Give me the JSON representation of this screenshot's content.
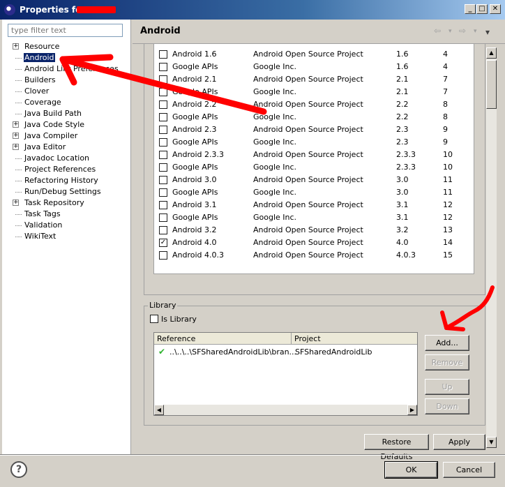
{
  "window": {
    "title": "Properties for",
    "buttons": {
      "minimize": "_",
      "maximize": "□",
      "close": "✕"
    }
  },
  "filter": {
    "placeholder": "type filter text"
  },
  "tree": [
    {
      "label": "Resource",
      "expandable": true,
      "selected": false
    },
    {
      "label": "Android",
      "expandable": false,
      "selected": true
    },
    {
      "label": "Android Lint Preferences",
      "expandable": false,
      "selected": false
    },
    {
      "label": "Builders",
      "expandable": false,
      "selected": false
    },
    {
      "label": "Clover",
      "expandable": false,
      "selected": false
    },
    {
      "label": "Coverage",
      "expandable": false,
      "selected": false
    },
    {
      "label": "Java Build Path",
      "expandable": false,
      "selected": false
    },
    {
      "label": "Java Code Style",
      "expandable": true,
      "selected": false
    },
    {
      "label": "Java Compiler",
      "expandable": true,
      "selected": false
    },
    {
      "label": "Java Editor",
      "expandable": true,
      "selected": false
    },
    {
      "label": "Javadoc Location",
      "expandable": false,
      "selected": false
    },
    {
      "label": "Project References",
      "expandable": false,
      "selected": false
    },
    {
      "label": "Refactoring History",
      "expandable": false,
      "selected": false
    },
    {
      "label": "Run/Debug Settings",
      "expandable": false,
      "selected": false
    },
    {
      "label": "Task Repository",
      "expandable": true,
      "selected": false
    },
    {
      "label": "Task Tags",
      "expandable": false,
      "selected": false
    },
    {
      "label": "Validation",
      "expandable": false,
      "selected": false
    },
    {
      "label": "WikiText",
      "expandable": false,
      "selected": false
    }
  ],
  "page": {
    "title": "Android"
  },
  "nav": {
    "back": "⇦",
    "forward": "⇨",
    "menu": "▾"
  },
  "targets": [
    {
      "name": "Android 1.6",
      "vendor": "Android Open Source Project",
      "platform": "1.6",
      "api": "4",
      "checked": false
    },
    {
      "name": "Google APIs",
      "vendor": "Google Inc.",
      "platform": "1.6",
      "api": "4",
      "checked": false
    },
    {
      "name": "Android 2.1",
      "vendor": "Android Open Source Project",
      "platform": "2.1",
      "api": "7",
      "checked": false
    },
    {
      "name": "Google APIs",
      "vendor": "Google Inc.",
      "platform": "2.1",
      "api": "7",
      "checked": false
    },
    {
      "name": "Android 2.2",
      "vendor": "Android Open Source Project",
      "platform": "2.2",
      "api": "8",
      "checked": false
    },
    {
      "name": "Google APIs",
      "vendor": "Google Inc.",
      "platform": "2.2",
      "api": "8",
      "checked": false
    },
    {
      "name": "Android 2.3",
      "vendor": "Android Open Source Project",
      "platform": "2.3",
      "api": "9",
      "checked": false
    },
    {
      "name": "Google APIs",
      "vendor": "Google Inc.",
      "platform": "2.3",
      "api": "9",
      "checked": false
    },
    {
      "name": "Android 2.3.3",
      "vendor": "Android Open Source Project",
      "platform": "2.3.3",
      "api": "10",
      "checked": false
    },
    {
      "name": "Google APIs",
      "vendor": "Google Inc.",
      "platform": "2.3.3",
      "api": "10",
      "checked": false
    },
    {
      "name": "Android 3.0",
      "vendor": "Android Open Source Project",
      "platform": "3.0",
      "api": "11",
      "checked": false
    },
    {
      "name": "Google APIs",
      "vendor": "Google Inc.",
      "platform": "3.0",
      "api": "11",
      "checked": false
    },
    {
      "name": "Android 3.1",
      "vendor": "Android Open Source Project",
      "platform": "3.1",
      "api": "12",
      "checked": false
    },
    {
      "name": "Google APIs",
      "vendor": "Google Inc.",
      "platform": "3.1",
      "api": "12",
      "checked": false
    },
    {
      "name": "Android 3.2",
      "vendor": "Android Open Source Project",
      "platform": "3.2",
      "api": "13",
      "checked": false
    },
    {
      "name": "Android 4.0",
      "vendor": "Android Open Source Project",
      "platform": "4.0",
      "api": "14",
      "checked": true
    },
    {
      "name": "Android 4.0.3",
      "vendor": "Android Open Source Project",
      "platform": "4.0.3",
      "api": "15",
      "checked": false
    }
  ],
  "library": {
    "legend": "Library",
    "is_library_label": "Is Library",
    "is_library_checked": false,
    "columns": {
      "reference": "Reference",
      "project": "Project"
    },
    "rows": [
      {
        "reference": "..\\..\\..\\SFSharedAndroidLib\\bran...",
        "project": "SFSharedAndroidLib",
        "status_icon": "check-icon"
      }
    ],
    "buttons": {
      "add": "Add...",
      "remove": "Remove",
      "up": "Up",
      "down": "Down"
    }
  },
  "actions": {
    "restore_defaults": "Restore Defaults",
    "apply": "Apply"
  },
  "footer": {
    "help": "?",
    "ok": "OK",
    "cancel": "Cancel"
  },
  "colors": {
    "annotation": "#ff0000",
    "selection": "#0a246a",
    "check": "#2fb32f"
  }
}
